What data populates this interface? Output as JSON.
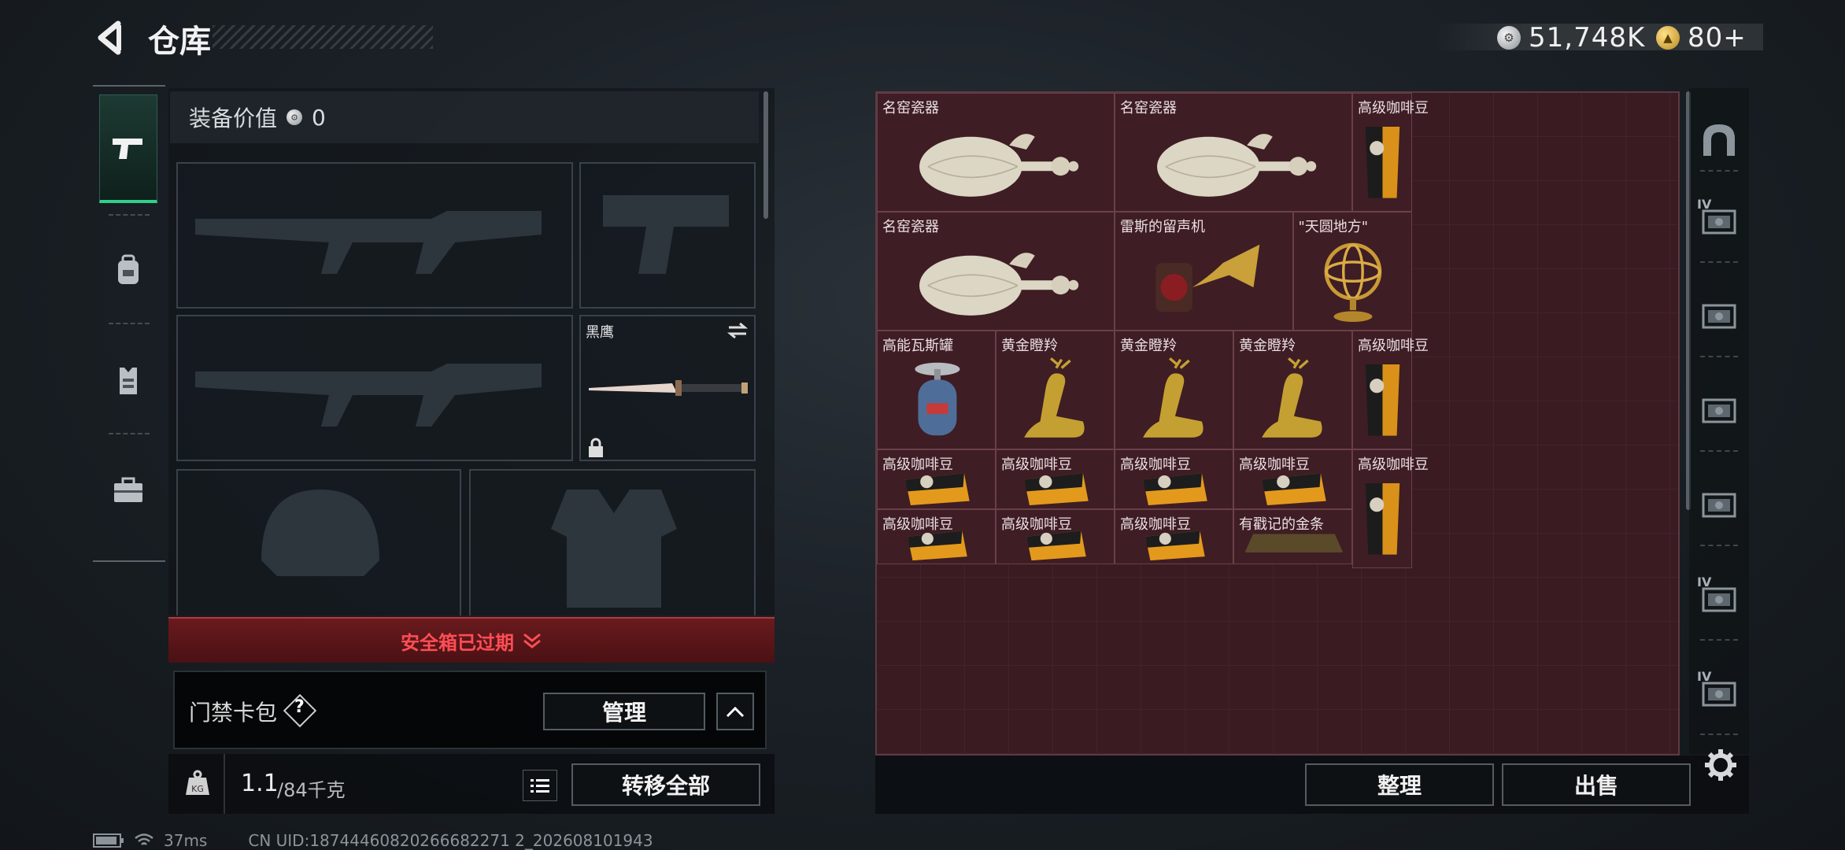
{
  "header": {
    "title": "仓库",
    "silver_amount": "51,748K",
    "gold_amount": "80+",
    "silver_icon": "silver-coin-icon",
    "gold_icon": "gold-coin-icon"
  },
  "tabs": [
    {
      "name": "weapons",
      "icon": "pistol-icon",
      "active": true
    },
    {
      "name": "gear",
      "icon": "backpack-icon",
      "active": false
    },
    {
      "name": "armor",
      "icon": "vest-icon",
      "active": false
    },
    {
      "name": "tools",
      "icon": "toolbox-icon",
      "active": false
    }
  ],
  "equipment": {
    "value_label": "装备价值",
    "value": "0",
    "knife_label": "黑鹰"
  },
  "safebox": {
    "status": "安全箱已过期"
  },
  "keycard": {
    "label": "门禁卡包",
    "help": "?",
    "manage_button": "管理"
  },
  "weight": {
    "current": "1.1",
    "max": "/84千克",
    "transfer_button": "转移全部"
  },
  "stash": {
    "items": [
      {
        "label": "名窑瓷器",
        "type": "vase"
      },
      {
        "label": "名窑瓷器",
        "type": "vase"
      },
      {
        "label": "高级咖啡豆",
        "type": "coffee-bag"
      },
      {
        "label": "名窑瓷器",
        "type": "vase"
      },
      {
        "label": "雷斯的留声机",
        "type": "phonograph"
      },
      {
        "label": "\"天圆地方\"",
        "type": "globe"
      },
      {
        "label": "高能瓦斯罐",
        "type": "gas"
      },
      {
        "label": "黄金瞪羚",
        "type": "deer"
      },
      {
        "label": "黄金瞪羚",
        "type": "deer"
      },
      {
        "label": "黄金瞪羚",
        "type": "deer"
      },
      {
        "label": "高级咖啡豆",
        "type": "coffee-bag"
      },
      {
        "label": "高级咖啡豆",
        "type": "coffee-flat"
      },
      {
        "label": "高级咖啡豆",
        "type": "coffee-flat"
      },
      {
        "label": "高级咖啡豆",
        "type": "coffee-flat"
      },
      {
        "label": "高级咖啡豆",
        "type": "coffee-flat"
      },
      {
        "label": "高级咖啡豆",
        "type": "coffee-bag"
      },
      {
        "label": "高级咖啡豆",
        "type": "coffee-flat"
      },
      {
        "label": "高级咖啡豆",
        "type": "coffee-flat"
      },
      {
        "label": "高级咖啡豆",
        "type": "coffee-flat"
      },
      {
        "label": "有戳记的金条",
        "type": "gold-bar"
      }
    ],
    "sort_button": "整理",
    "sell_button": "出售"
  },
  "right_tabs": [
    {
      "icon": "safe-icon"
    },
    {
      "icon": "case-iv-icon",
      "tier": "IV"
    },
    {
      "icon": "case-icon"
    },
    {
      "icon": "case-icon"
    },
    {
      "icon": "case-icon"
    },
    {
      "icon": "case-iv-icon",
      "tier": "IV"
    },
    {
      "icon": "case-iv-icon",
      "tier": "IV"
    }
  ],
  "status": {
    "ping": "37ms",
    "uid": "CN UID:18744460820266682271 2_202608101943"
  },
  "colors": {
    "accent_green": "#2fd08b",
    "expired_red": "#ff4d55",
    "stash_bg": "#3f1d24"
  }
}
